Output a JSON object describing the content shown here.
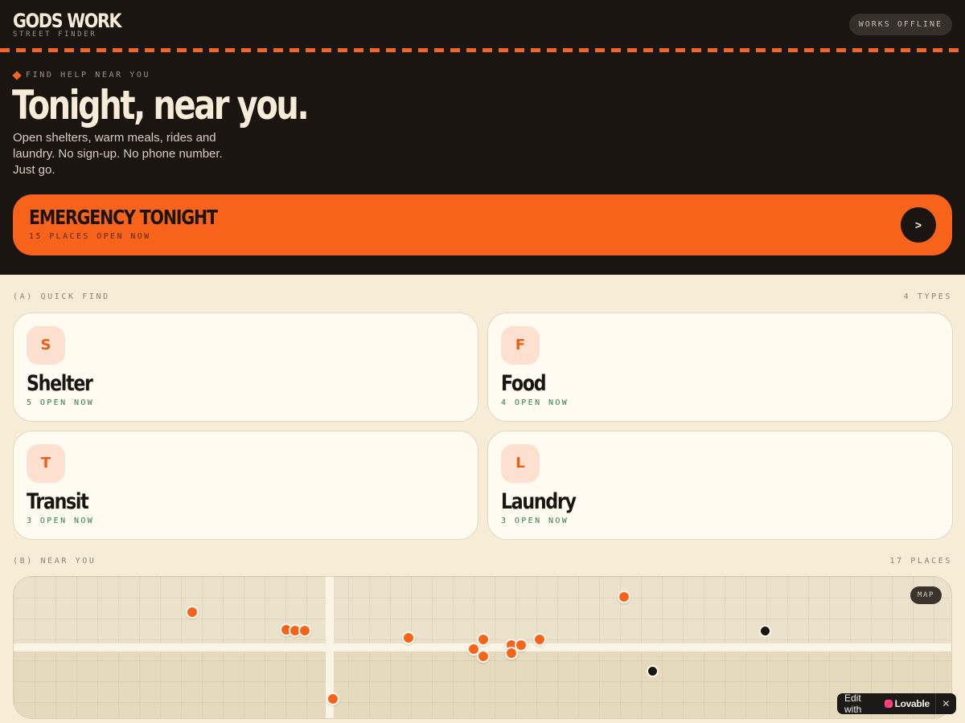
{
  "header": {
    "brand": "GODS WORK",
    "brand_sub": "STREET FINDER",
    "offline_badge": "WORKS OFFLINE"
  },
  "hero": {
    "eyebrow": "FIND HELP NEAR YOU",
    "headline": "Tonight, near you.",
    "intro": "Open shelters, warm meals, rides and laundry. No sign-up. No phone number. Just go."
  },
  "emergency": {
    "title": "EMERGENCY TONIGHT",
    "subtitle": "15 PLACES OPEN NOW",
    "go_label": ">"
  },
  "quick_find": {
    "label": "(A) QUICK FIND",
    "count": "4 TYPES",
    "cards": [
      {
        "initial": "S",
        "title": "Shelter",
        "status": "5 OPEN NOW"
      },
      {
        "initial": "F",
        "title": "Food",
        "status": "4 OPEN NOW"
      },
      {
        "initial": "T",
        "title": "Transit",
        "status": "3 OPEN NOW"
      },
      {
        "initial": "L",
        "title": "Laundry",
        "status": "3 OPEN NOW"
      }
    ]
  },
  "near_you": {
    "label": "(B) NEAR YOU",
    "count": "17 PLACES",
    "map_tag": "MAP"
  },
  "lovable": {
    "edit": "Edit with",
    "name": "Lovable",
    "close": "✕"
  },
  "colors": {
    "accent": "#f7631b",
    "dark": "#1b1512",
    "cream": "#f7ecd6",
    "open_status": "#2f7d4c"
  }
}
